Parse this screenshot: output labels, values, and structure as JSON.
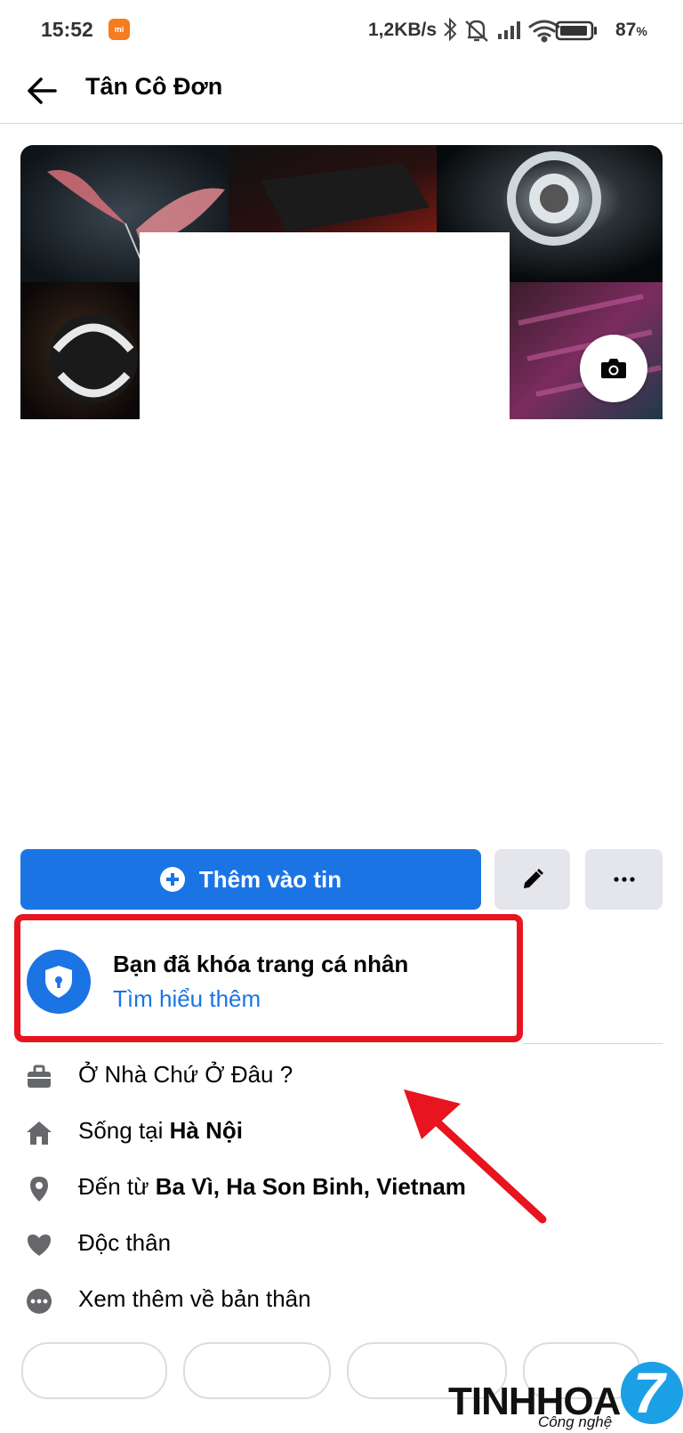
{
  "status_bar": {
    "time": "15:52",
    "network_speed": "1,2KB/s",
    "battery_percent": "87",
    "battery_unit": "%",
    "icons": [
      "mi-app-icon",
      "bluetooth-icon",
      "bell-off-icon",
      "signal-icon",
      "wifi-icon",
      "battery-icon"
    ]
  },
  "header": {
    "title": "Tân Cô Đơn"
  },
  "actions": {
    "add_story_label": "Thêm vào tin"
  },
  "lock_notice": {
    "title": "Bạn đã khóa trang cá nhân",
    "link": "Tìm hiểu thêm"
  },
  "info": {
    "work": "Ở Nhà Chứ Ở Đâu ?",
    "lives_prefix": "Sống tại ",
    "lives_place": "Hà Nội",
    "from_prefix": "Đến từ ",
    "from_place": "Ba Vì, Ha Son Binh, Vietnam",
    "relationship": "Độc thân",
    "see_more": "Xem thêm về bản thân"
  },
  "watermark": {
    "brand": "TINHHOA",
    "sub": "Công nghệ",
    "badge": "7"
  },
  "colors": {
    "accent": "#1b74e4",
    "highlight": "#e8141f",
    "button_grey": "#e4e6eb"
  }
}
